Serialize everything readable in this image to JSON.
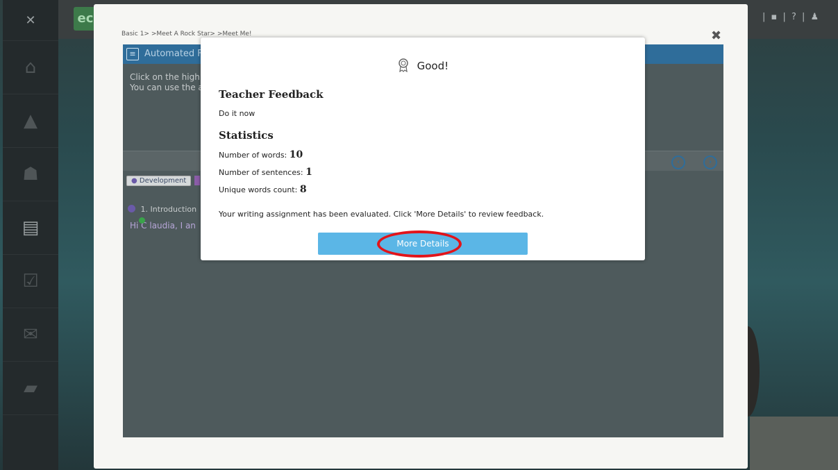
{
  "background": {
    "sidebar_icons": [
      "close-icon",
      "home-icon",
      "graduation-cap-icon",
      "group-icon",
      "clipboard-icon",
      "task-icon",
      "mail-icon",
      "book-icon"
    ],
    "topbar": {
      "logo_text": "ec",
      "right_glyphs": "| ▪ | ? | ♟"
    }
  },
  "activity": {
    "breadcrumb": "Basic 1> >Meet A Rock Star> >Meet Me!",
    "header_title": "Automated F",
    "instructions": [
      "Click on the highli",
      "You can use the a"
    ],
    "tag": "Development",
    "intro_label": "1. Introduction",
    "text_preview": "Hi C laudia, I an"
  },
  "modal": {
    "title": "Good!",
    "teacher_feedback_heading": "Teacher Feedback",
    "teacher_feedback_text": "Do it now",
    "statistics_heading": "Statistics",
    "stats": {
      "words_label": "Number of words:",
      "words_value": "10",
      "sentences_label": "Number of sentences:",
      "sentences_value": "1",
      "unique_label": "Unique words count:",
      "unique_value": "8"
    },
    "message": "Your writing assignment has been evaluated. Click 'More Details' to review feedback.",
    "button_label": "More Details"
  },
  "colors": {
    "button": "#5bb6e6",
    "highlight_circle": "#e2141a",
    "panel_header": "#2f6d9a"
  }
}
